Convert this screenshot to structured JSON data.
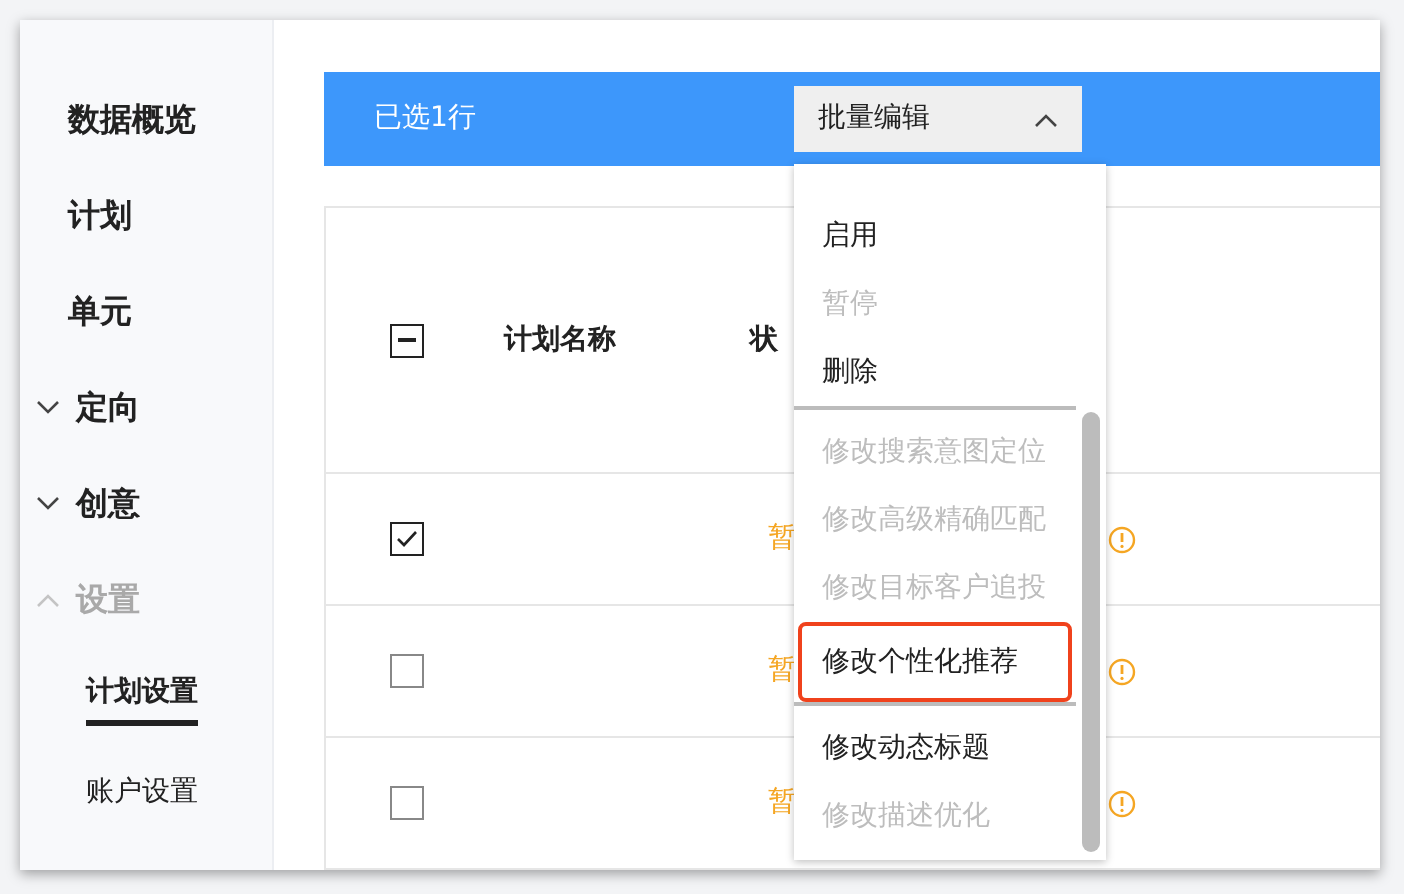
{
  "sidebar": {
    "items": [
      {
        "label": "数据概览",
        "kind": "plain",
        "disabled": false
      },
      {
        "label": "计划",
        "kind": "plain",
        "disabled": false
      },
      {
        "label": "单元",
        "kind": "plain",
        "disabled": false
      },
      {
        "label": "定向",
        "kind": "group",
        "expanded": false,
        "disabled": false
      },
      {
        "label": "创意",
        "kind": "group",
        "expanded": false,
        "disabled": false
      },
      {
        "label": "设置",
        "kind": "group",
        "expanded": true,
        "disabled": true
      },
      {
        "label": "计划设置",
        "kind": "sub",
        "selected": true,
        "disabled": false
      },
      {
        "label": "账户设置",
        "kind": "sub",
        "selected": false,
        "disabled": false
      }
    ]
  },
  "selection_bar": {
    "text": "已选1行",
    "bulk_edit": {
      "label": "批量编辑",
      "expanded": true
    }
  },
  "table": {
    "header": {
      "indeterminate": true,
      "columns": [
        "计划名称",
        "状"
      ]
    },
    "rows": [
      {
        "checked": true,
        "status": "暂"
      },
      {
        "checked": false,
        "status": "暂"
      },
      {
        "checked": false,
        "status": "暂"
      }
    ]
  },
  "bulk_menu": {
    "items": [
      {
        "kind": "option",
        "label": "启用",
        "disabled": false,
        "highlighted": false
      },
      {
        "kind": "option",
        "label": "暂停",
        "disabled": true,
        "highlighted": false
      },
      {
        "kind": "option",
        "label": "删除",
        "disabled": false,
        "highlighted": false
      },
      {
        "kind": "divider"
      },
      {
        "kind": "option",
        "label": "修改搜索意图定位",
        "disabled": true,
        "highlighted": false
      },
      {
        "kind": "option",
        "label": "修改高级精确匹配",
        "disabled": true,
        "highlighted": false
      },
      {
        "kind": "option",
        "label": "修改目标客户追投",
        "disabled": true,
        "highlighted": false
      },
      {
        "kind": "option",
        "label": "修改个性化推荐",
        "disabled": false,
        "highlighted": true
      },
      {
        "kind": "divider"
      },
      {
        "kind": "option",
        "label": "修改动态标题",
        "disabled": false,
        "highlighted": false
      },
      {
        "kind": "option",
        "label": "修改描述优化",
        "disabled": true,
        "highlighted": false
      }
    ]
  }
}
